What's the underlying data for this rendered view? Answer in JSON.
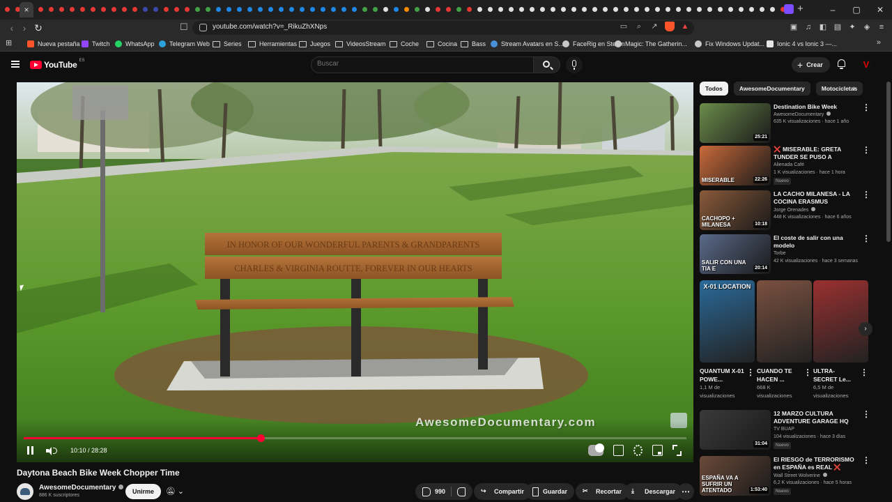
{
  "browser": {
    "active_tab_close": "×",
    "new_tab": "+",
    "url": "youtube.com/watch?v=_RikuZhXNps",
    "window_controls": [
      "–",
      "▢",
      "✕"
    ]
  },
  "bookmarks": [
    {
      "label": "Nueva pestaña",
      "icon": "brave-icon",
      "color": "#fb542b"
    },
    {
      "label": "Twitch",
      "icon": "twitch-icon",
      "color": "#9146ff"
    },
    {
      "label": "WhatsApp",
      "icon": "whatsapp-icon",
      "color": "#25d366"
    },
    {
      "label": "Telegram Web",
      "icon": "telegram-icon",
      "color": "#2aa1da"
    },
    {
      "label": "Series",
      "icon": "folder-icon"
    },
    {
      "label": "Herramientas",
      "icon": "folder-icon"
    },
    {
      "label": "Juegos",
      "icon": "folder-icon"
    },
    {
      "label": "VideosStream",
      "icon": "folder-icon"
    },
    {
      "label": "Coche",
      "icon": "folder-icon"
    },
    {
      "label": "Cocina",
      "icon": "folder-icon"
    },
    {
      "label": "Bass",
      "icon": "folder-icon"
    },
    {
      "label": "Stream Avatars en S...",
      "icon": "steam-icon",
      "color": "#4a90d9"
    },
    {
      "label": "FaceRig en Steam",
      "icon": "steam-icon",
      "color": "#c8c8c8"
    },
    {
      "label": "Magic: The Gatherin...",
      "icon": "magic-icon",
      "color": "#c8c8c8"
    },
    {
      "label": "Fix Windows Updat...",
      "icon": "web-icon",
      "color": "#c8c8c8"
    },
    {
      "label": "Ionic 4 vs Ionic 3 —...",
      "icon": "medium-icon",
      "color": "#e5e5e5"
    }
  ],
  "youtube": {
    "logo_text": "YouTube",
    "region": "ES",
    "search_placeholder": "Buscar",
    "create_label": "Crear",
    "avatar_letter": "V"
  },
  "player": {
    "time": "10:10 / 28:28",
    "progress": 0.357,
    "watermark": "AwesomeDocumentary.com",
    "sign_line1": "IN HONOR OF OUR WONDERFUL PARENTS & GRANDPARENTS",
    "sign_line2": "CHARLES & VIRGINIA ROUTTE, FOREVER IN OUR HEARTS"
  },
  "video": {
    "title": "Daytona Beach Bike Week Chopper Time",
    "channel": "AwesomeDocumentary",
    "subscribers": "886 K suscriptores",
    "join_label": "Unirme",
    "likes": "990",
    "share_label": "Compartir",
    "save_label": "Guardar",
    "clip_label": "Recortar",
    "download_label": "Descargar"
  },
  "chips": [
    "Todos",
    "AwesomeDocumentary",
    "Motocicletas"
  ],
  "recommendations": [
    {
      "title": "Destination Bike Week",
      "channel": "AwesomeDocumentary",
      "meta": "635 K visualizaciones · hace 1 año",
      "duration": "25:21",
      "thumb_color": "#6b8c4a",
      "verified": true,
      "new": false
    },
    {
      "title": "❌ MISERABLE: GRETA TUNDER SE PUSO A DEFENDE...",
      "channel": "Alienada Café",
      "meta": "1 K visualizaciones · hace 1 hora",
      "duration": "22:26",
      "thumb_color": "#c96a3a",
      "thumb_text": "MISERABLE",
      "verified": false,
      "new": true,
      "new_label": "Nuevo"
    },
    {
      "title": "LA CACHO MILANESA - LA COCINA ERASMUS",
      "channel": "Jorge Orenades",
      "meta": "448 K visualizaciones · hace 6 años",
      "duration": "10:18",
      "thumb_color": "#8a5a3a",
      "thumb_text": "CACHOPO + MILANESA",
      "verified": true,
      "new": false
    },
    {
      "title": "El coste de salir con una modelo",
      "channel": "Torbe",
      "meta": "42 K visualizaciones · hace 3 semanas",
      "duration": "20:14",
      "thumb_color": "#5a6a8a",
      "thumb_text": "SALIR CON UNA TIA E",
      "verified": false,
      "new": false
    }
  ],
  "shorts": [
    {
      "title": "QUANTUM X-01 POWE...",
      "views": "1,1 M de visualizaciones",
      "thumb_color": "#2a6a9a",
      "thumb_text": "X-01 LOCATION"
    },
    {
      "title": "CUANDO TE HACEN ...",
      "views": "668 K visualizaciones",
      "thumb_color": "#7a5040"
    },
    {
      "title": "ULTRA-SECRET Le...",
      "views": "6,5 M de visualizaciones",
      "thumb_color": "#9a3030"
    }
  ],
  "recommendations_lower": [
    {
      "title": "12 MARZO CULTURA ADVENTURE GARAGE HQ",
      "channel": "TV BUAP",
      "meta": "104 visualizaciones · hace 3 días",
      "duration": "31:04",
      "thumb_color": "#3a3a3a",
      "new": true,
      "new_label": "Nuevo",
      "verified": false
    },
    {
      "title": "El RIESGO de TERRORISMO en ESPAÑA es REAL ❌ RUBÉN ...",
      "channel": "Wall Street Wolverine",
      "meta": "6,2 K visualizaciones · hace 5 horas",
      "duration": "1:53:40",
      "thumb_color": "#6a4a3a",
      "thumb_text": "ESPAÑA VA A SUFRIR UN ATENTADO",
      "new": true,
      "new_label": "Nuevo",
      "verified": true
    }
  ],
  "colors": {
    "accent_red": "#ff0033",
    "background": "#0f0f0f",
    "chip_bg": "#272727"
  }
}
